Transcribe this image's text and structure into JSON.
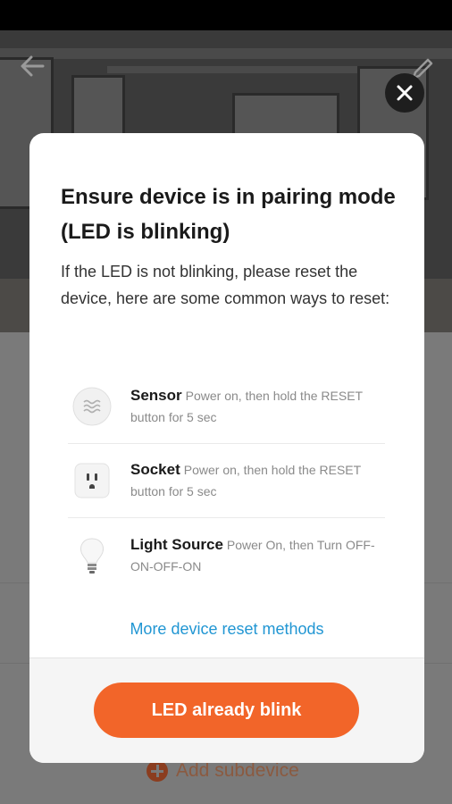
{
  "background": {
    "add_subdevice_label": "Add subdevice",
    "back_icon": "arrow-left-icon",
    "edit_icon": "pencil-icon",
    "plus_icon": "plus-circle-icon"
  },
  "dialog": {
    "close_icon": "close-icon",
    "title": "Ensure device is in pairing mode (LED is blinking)",
    "description": "If the LED is not blinking, please reset the device, here are some common ways to reset:",
    "methods": [
      {
        "icon": "sensor-icon",
        "name": "Sensor",
        "text": "Power on, then hold the RESET button for 5 sec"
      },
      {
        "icon": "socket-icon",
        "name": "Socket",
        "text": "Power on, then hold the RESET button for 5 sec"
      },
      {
        "icon": "light-bulb-icon",
        "name": "Light Source",
        "text": "Power On, then Turn OFF-ON-OFF-ON"
      }
    ],
    "more_link": "More device reset methods",
    "primary_button": "LED already blink"
  },
  "colors": {
    "accent": "#f26529",
    "link": "#2196d3",
    "overlay": "#000000"
  }
}
